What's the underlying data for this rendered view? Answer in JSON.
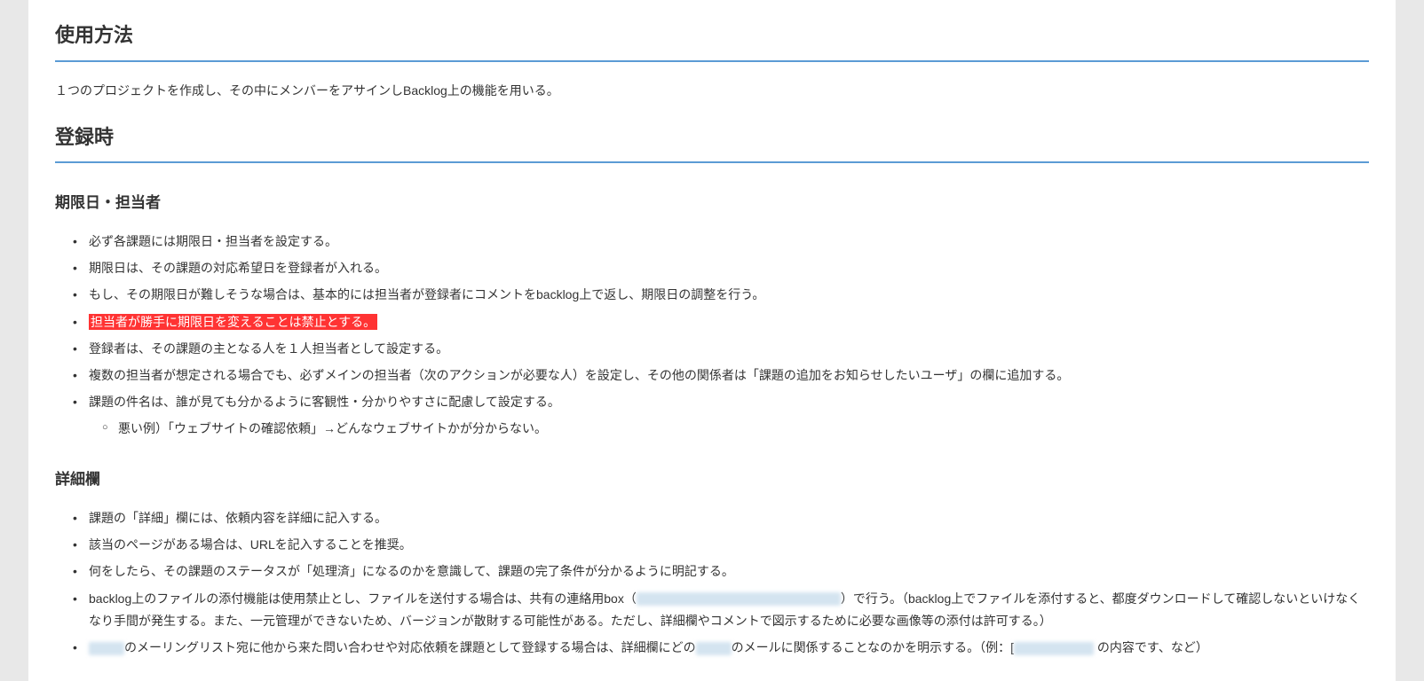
{
  "section1": {
    "title": "使用方法",
    "paragraph": "１つのプロジェクトを作成し、その中にメンバーをアサインしBacklog上の機能を用いる。"
  },
  "section2": {
    "title": "登録時",
    "sub1": {
      "title": "期限日・担当者",
      "items": [
        "必ず各課題には期限日・担当者を設定する。",
        "期限日は、その課題の対応希望日を登録者が入れる。",
        "もし、その期限日が難しそうな場合は、基本的には担当者が登録者にコメントをbacklog上で返し、期限日の調整を行う。",
        "担当者が勝手に期限日を変えることは禁止とする。",
        "登録者は、その課題の主となる人を１人担当者として設定する。",
        "複数の担当者が想定される場合でも、必ずメインの担当者（次のアクションが必要な人）を設定し、その他の関係者は「課題の追加をお知らせしたいユーザ」の欄に追加する。",
        "課題の件名は、誰が見ても分かるように客観性・分かりやすさに配慮して設定する。"
      ],
      "subitem": "悪い例）「ウェブサイトの確認依頼」→どんなウェブサイトかが分からない。"
    },
    "sub2": {
      "title": "詳細欄",
      "items": [
        "課題の「詳細」欄には、依頼内容を詳細に記入する。",
        "該当のページがある場合は、URLを記入することを推奨。",
        "何をしたら、その課題のステータスが「処理済」になるのかを意識して、課題の完了条件が分かるように明記する。"
      ],
      "item4_part1": "backlog上のファイルの添付機能は使用禁止とし、ファイルを送付する場合は、共有の連絡用box（",
      "item4_part2": "）で行う。（backlog上でファイルを添付すると、都度ダウンロードして確認しないといけなくなり手間が発生する。また、一元管理ができないため、バージョンが散財する可能性がある。ただし、詳細欄やコメントで図示するために必要な画像等の添付は許可する。）",
      "item5_part1": "のメーリングリスト宛に他から来た問い合わせや対応依頼を課題として登録する場合は、詳細欄にどの",
      "item5_part2": "のメールに関係することなのかを明示する。（例：[",
      "item5_part3": " の内容です、など）"
    }
  }
}
